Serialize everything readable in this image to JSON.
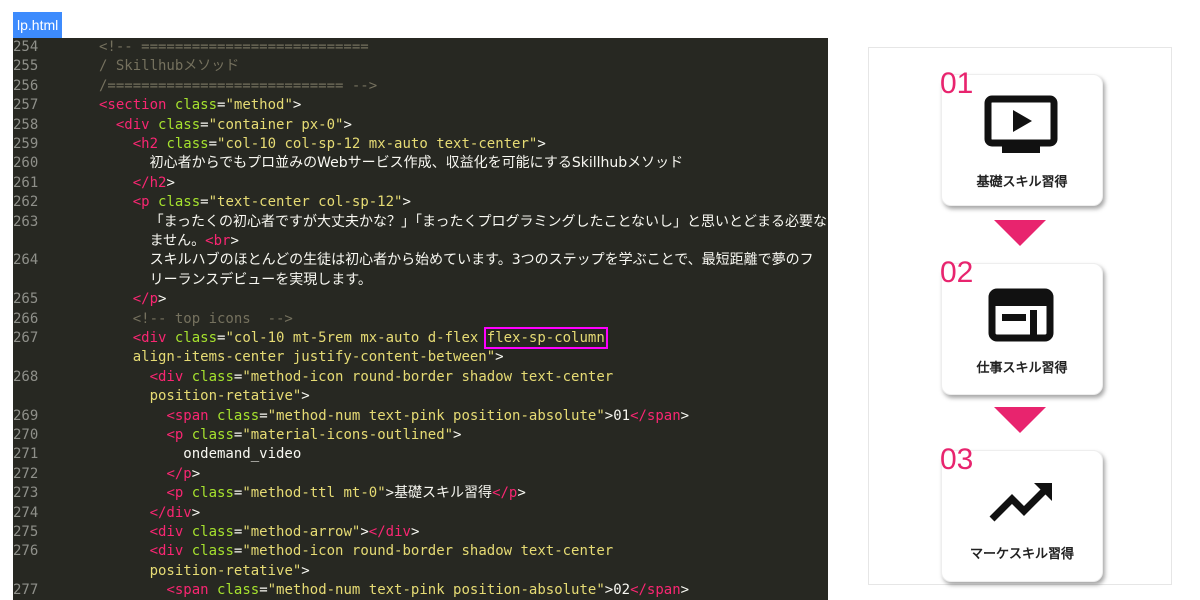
{
  "tab": {
    "label": "lp.html"
  },
  "lines": [
    {
      "n": "254",
      "t": [
        [
          "c",
          "<!-- ==========================="
        ]
      ]
    },
    {
      "n": "255",
      "t": [
        [
          "c",
          "/ Skillhubメソッド"
        ]
      ]
    },
    {
      "n": "256",
      "t": [
        [
          "c",
          "/============================ -->"
        ]
      ]
    },
    {
      "n": "257",
      "t": [
        [
          "t",
          "<section"
        ],
        [
          "p",
          " "
        ],
        [
          "a",
          "class"
        ],
        [
          "p",
          "="
        ],
        [
          "s",
          "\"method\""
        ],
        [
          "p",
          ">"
        ]
      ]
    },
    {
      "n": "258",
      "t": [
        [
          "p",
          "  "
        ],
        [
          "t",
          "<div"
        ],
        [
          "p",
          " "
        ],
        [
          "a",
          "class"
        ],
        [
          "p",
          "="
        ],
        [
          "s",
          "\"container px-0\""
        ],
        [
          "p",
          ">"
        ]
      ]
    },
    {
      "n": "259",
      "t": [
        [
          "p",
          "    "
        ],
        [
          "t",
          "<h2"
        ],
        [
          "p",
          " "
        ],
        [
          "a",
          "class"
        ],
        [
          "p",
          "="
        ],
        [
          "s",
          "\"col-10 col-sp-12 mx-auto text-center\""
        ],
        [
          "p",
          ">"
        ]
      ]
    },
    {
      "n": "260",
      "t": [
        [
          "p",
          "      "
        ],
        [
          "j",
          "初心者からでもプロ並みのWebサービス作成、収益化を可能にするSkillhubメソッド"
        ]
      ]
    },
    {
      "n": "261",
      "t": [
        [
          "p",
          "    "
        ],
        [
          "t",
          "</h2"
        ],
        [
          "p",
          ">"
        ]
      ]
    },
    {
      "n": "262",
      "t": [
        [
          "p",
          "    "
        ],
        [
          "t",
          "<p"
        ],
        [
          "p",
          " "
        ],
        [
          "a",
          "class"
        ],
        [
          "p",
          "="
        ],
        [
          "s",
          "\"text-center col-sp-12\""
        ],
        [
          "p",
          ">"
        ]
      ]
    },
    {
      "n": "263",
      "t": [
        [
          "p",
          "      "
        ],
        [
          "j",
          "「まったくの初心者ですが大丈夫かな？」「まったくプログラミングしたことないし」と思いとどまる必要なあり"
        ]
      ]
    },
    {
      "n": "",
      "t": [
        [
          "p",
          "      "
        ],
        [
          "j",
          "ません。"
        ],
        [
          "t",
          "<br"
        ],
        [
          "p",
          ">"
        ]
      ]
    },
    {
      "n": "264",
      "t": [
        [
          "p",
          "      "
        ],
        [
          "j",
          "スキルハブのほとんどの生徒は初心者から始めています。3つのステップを学ぶことで、最短距離で夢のフ"
        ]
      ]
    },
    {
      "n": "",
      "t": [
        [
          "p",
          "      "
        ],
        [
          "j",
          "リーランスデビューを実現します。"
        ]
      ]
    },
    {
      "n": "265",
      "t": [
        [
          "p",
          "    "
        ],
        [
          "t",
          "</p"
        ],
        [
          "p",
          ">"
        ]
      ]
    },
    {
      "n": "266",
      "t": [
        [
          "p",
          "    "
        ],
        [
          "c",
          "<!-- top icons  -->"
        ]
      ]
    },
    {
      "n": "267",
      "t": [
        [
          "p",
          "    "
        ],
        [
          "t",
          "<div"
        ],
        [
          "p",
          " "
        ],
        [
          "a",
          "class"
        ],
        [
          "p",
          "="
        ],
        [
          "s",
          "\"col-10 mt-5rem mx-auto d-flex "
        ],
        [
          "h",
          "flex-sp-column"
        ]
      ]
    },
    {
      "n": "",
      "t": [
        [
          "p",
          "    "
        ],
        [
          "s",
          "align-items-center justify-content-between\""
        ],
        [
          "p",
          ">"
        ]
      ]
    },
    {
      "n": "268",
      "t": [
        [
          "p",
          "      "
        ],
        [
          "t",
          "<div"
        ],
        [
          "p",
          " "
        ],
        [
          "a",
          "class"
        ],
        [
          "p",
          "="
        ],
        [
          "s",
          "\"method-icon round-border shadow text-center"
        ]
      ]
    },
    {
      "n": "",
      "t": [
        [
          "p",
          "      "
        ],
        [
          "s",
          "position-retative\""
        ],
        [
          "p",
          ">"
        ]
      ]
    },
    {
      "n": "269",
      "t": [
        [
          "p",
          "        "
        ],
        [
          "t",
          "<span"
        ],
        [
          "p",
          " "
        ],
        [
          "a",
          "class"
        ],
        [
          "p",
          "="
        ],
        [
          "s",
          "\"method-num text-pink position-absolute\""
        ],
        [
          "p",
          ">01"
        ],
        [
          "t",
          "</span"
        ],
        [
          "p",
          ">"
        ]
      ]
    },
    {
      "n": "270",
      "t": [
        [
          "p",
          "        "
        ],
        [
          "t",
          "<p"
        ],
        [
          "p",
          " "
        ],
        [
          "a",
          "class"
        ],
        [
          "p",
          "="
        ],
        [
          "s",
          "\"material-icons-outlined\""
        ],
        [
          "p",
          ">"
        ]
      ]
    },
    {
      "n": "271",
      "t": [
        [
          "p",
          "          ondemand_video"
        ]
      ]
    },
    {
      "n": "272",
      "t": [
        [
          "p",
          "        "
        ],
        [
          "t",
          "</p"
        ],
        [
          "p",
          ">"
        ]
      ]
    },
    {
      "n": "273",
      "t": [
        [
          "p",
          "        "
        ],
        [
          "t",
          "<p"
        ],
        [
          "p",
          " "
        ],
        [
          "a",
          "class"
        ],
        [
          "p",
          "="
        ],
        [
          "s",
          "\"method-ttl mt-0\""
        ],
        [
          "p",
          ">"
        ],
        [
          "j",
          "基礎スキル習得"
        ],
        [
          "t",
          "</p"
        ],
        [
          "p",
          ">"
        ]
      ]
    },
    {
      "n": "274",
      "t": [
        [
          "p",
          "      "
        ],
        [
          "t",
          "</div"
        ],
        [
          "p",
          ">"
        ]
      ]
    },
    {
      "n": "275",
      "t": [
        [
          "p",
          "      "
        ],
        [
          "t",
          "<div"
        ],
        [
          "p",
          " "
        ],
        [
          "a",
          "class"
        ],
        [
          "p",
          "="
        ],
        [
          "s",
          "\"method-arrow\""
        ],
        [
          "p",
          ">"
        ],
        [
          "t",
          "</div"
        ],
        [
          "p",
          ">"
        ]
      ]
    },
    {
      "n": "276",
      "t": [
        [
          "p",
          "      "
        ],
        [
          "t",
          "<div"
        ],
        [
          "p",
          " "
        ],
        [
          "a",
          "class"
        ],
        [
          "p",
          "="
        ],
        [
          "s",
          "\"method-icon round-border shadow text-center"
        ]
      ]
    },
    {
      "n": "",
      "t": [
        [
          "p",
          "      "
        ],
        [
          "s",
          "position-retative\""
        ],
        [
          "p",
          ">"
        ]
      ]
    },
    {
      "n": "277",
      "t": [
        [
          "p",
          "        "
        ],
        [
          "t",
          "<span"
        ],
        [
          "p",
          " "
        ],
        [
          "a",
          "class"
        ],
        [
          "p",
          "="
        ],
        [
          "s",
          "\"method-num text-pink position-absolute\""
        ],
        [
          "p",
          ">02"
        ],
        [
          "t",
          "</span"
        ],
        [
          "p",
          ">"
        ]
      ]
    }
  ],
  "preview": {
    "cards": [
      {
        "num": "01",
        "title": "基礎スキル習得",
        "icon": "ondemand-video-icon"
      },
      {
        "num": "02",
        "title": "仕事スキル習得",
        "icon": "web-layout-icon"
      },
      {
        "num": "03",
        "title": "マーケスキル習得",
        "icon": "trending-up-icon"
      }
    ],
    "accent_color": "#e8246e"
  }
}
